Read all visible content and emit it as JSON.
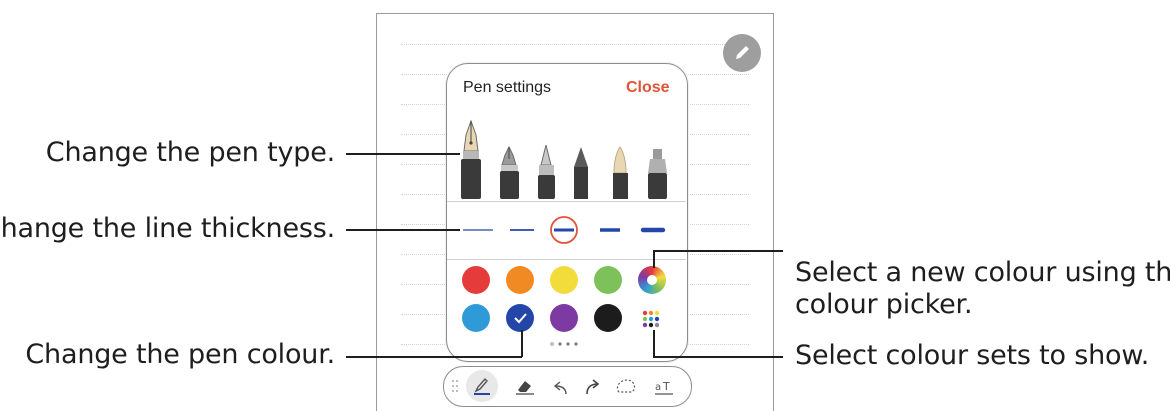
{
  "panel": {
    "title": "Pen settings",
    "close_label": "Close",
    "pen_types": [
      "fountain-pen",
      "calligraphy-pen",
      "pen",
      "pencil",
      "brush",
      "highlighter"
    ],
    "selected_pen": "fountain-pen",
    "thickness_options": 5,
    "selected_thickness_index": 2,
    "colors": [
      "#e63b3b",
      "#f28a24",
      "#f2dc3c",
      "#7cc15a",
      "rainbow",
      "#2e9bd8",
      "#2446a8",
      "#7e3aa3",
      "#1c1c1c",
      "multi-dots"
    ],
    "selected_color": "#2446a8",
    "page_dots": 4,
    "active_page": 0
  },
  "toolbar": {
    "items": [
      "drag-handle-icon",
      "pen-icon",
      "eraser-icon",
      "undo-icon",
      "redo-icon",
      "lasso-icon",
      "text-icon"
    ],
    "active": "pen-icon"
  },
  "callouts": {
    "pen_type": "Change the pen type.",
    "line_thickness": "Change the line thickness.",
    "pen_colour": "Change the pen colour.",
    "colour_picker_line1": "Select a new colour using the",
    "colour_picker_line2": "colour picker.",
    "colour_sets": "Select colour sets to show."
  },
  "accent_colors": {
    "close": "#e0543a",
    "selected_thickness": "#e0543a",
    "selected_color": "#2446a8"
  }
}
